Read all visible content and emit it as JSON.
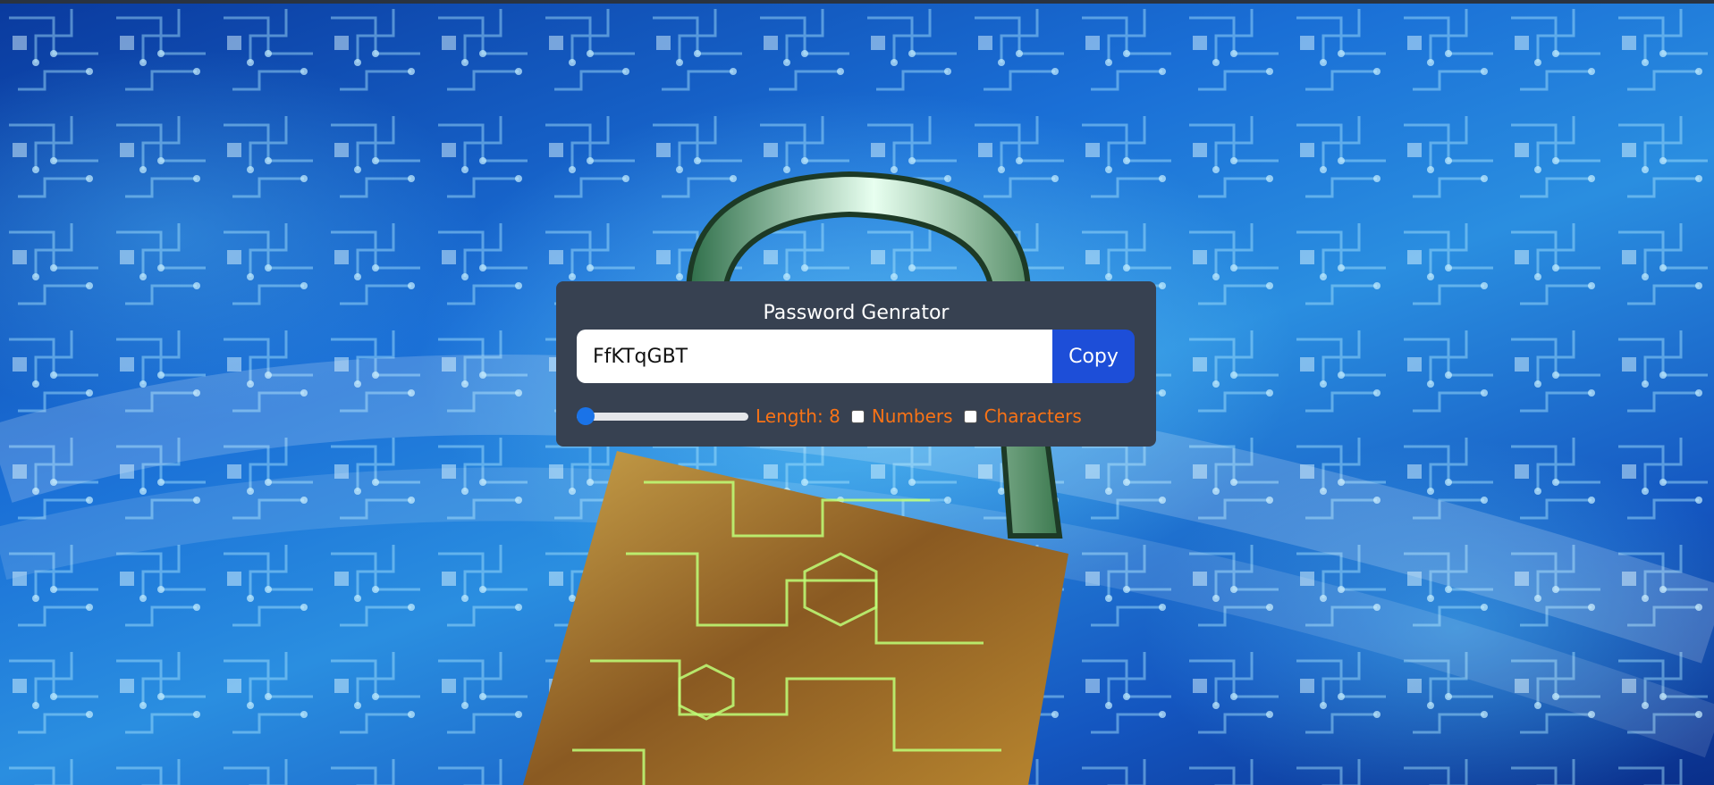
{
  "colors": {
    "panel_bg": "#374151",
    "accent_orange": "#f97316",
    "copy_button": "#1d4ed8",
    "background_blue": "#1a6fd6"
  },
  "background": {
    "image": "circuit-board-padlock"
  },
  "generator": {
    "title": "Password Genrator",
    "password_value": "FfKTqGBT",
    "copy_label": "Copy",
    "length": {
      "label": "Length: 8",
      "slider_fraction": 0.0
    },
    "numbers": {
      "label": "Numbers",
      "checked": false
    },
    "characters": {
      "label": "Characters",
      "checked": false
    }
  }
}
